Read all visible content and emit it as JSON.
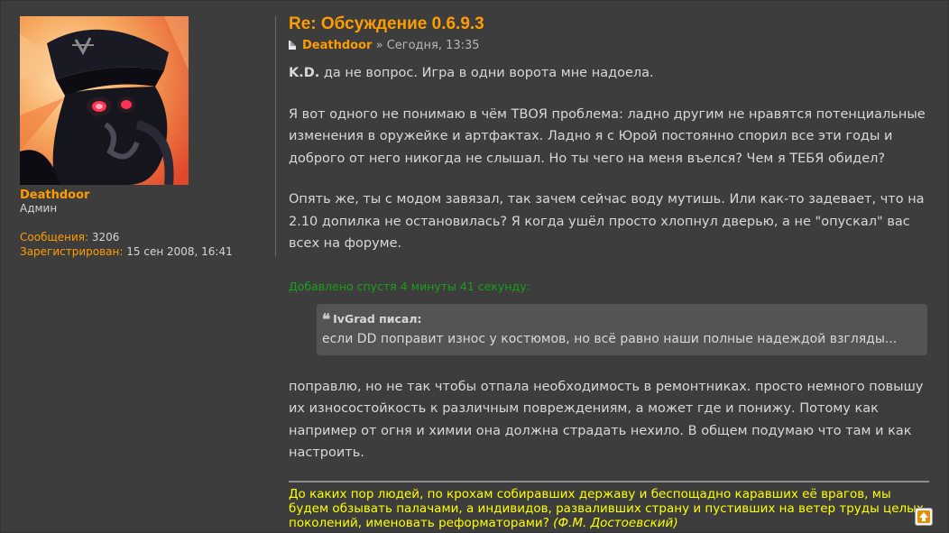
{
  "profile": {
    "username": "Deathdoor",
    "rank": "Админ",
    "posts_label": "Сообщения:",
    "posts_value": "3206",
    "registered_label": "Зарегистрирован:",
    "registered_value": "15 сен 2008, 16:41",
    "avatar_icon": "avatar-image"
  },
  "post": {
    "title": "Re: Обсуждение 0.6.9.3",
    "author": "Deathdoor",
    "separator": "»",
    "time": "Сегодня, 13:35",
    "p1_bold": "K.D.",
    "p1_text": "да не вопрос. Игра в одни ворота мне надоела.",
    "p2": "Я вот одного не понимаю в чём ТВОЯ проблема: ладно другим не нравятся потенциальные изменения в оружейке и артфактах. Ладно я с Юрой постоянно спорил все эти годы и доброго от него никогда не слышал. Но ты чего на меня въелся? Чем я ТЕБЯ обидел?",
    "p3": "Опять же, ты с модом завязал, так зачем сейчас воду мутишь. Или как-то задевает, что на 2.10 допилка не остановилась? Я когда ушёл просто хлопнул дверью, а не \"опускал\" вас всех на форуме.",
    "added_note": "Добавлено спустя 4 минуты 41 секунду:",
    "quote": {
      "mark": "❝",
      "author_line": "IvGrad писал:",
      "text": "если DD поправит износ у костюмов, но всё равно наши полные надеждой взгляды..."
    },
    "p4": "поправлю, но не так чтобы отпала необходимость в ремонтниках. просто немного повышу их износостойкость к различным повреждениям, а может где и понижу. Потому как например от огня и химии она должна страдать нехило. В общем подумаю что там и как настроить.",
    "signature_text": "До каких пор людей, по крохам собиравших державу и беспощадно каравших её врагов, мы будем обзывать палачами, а индивидов, разваливших страну и пустивших на ветер труды целых поколений, именовать реформаторами?",
    "signature_attrib": "(Ф.М. Достоевский)"
  },
  "colors": {
    "accent": "#ff9c00",
    "added_note": "#18a018",
    "signature": "#ffff00",
    "background": "#3d3d3d"
  },
  "icons": {
    "post_icon": "post-icon",
    "top_button": "arrow-up-icon"
  }
}
